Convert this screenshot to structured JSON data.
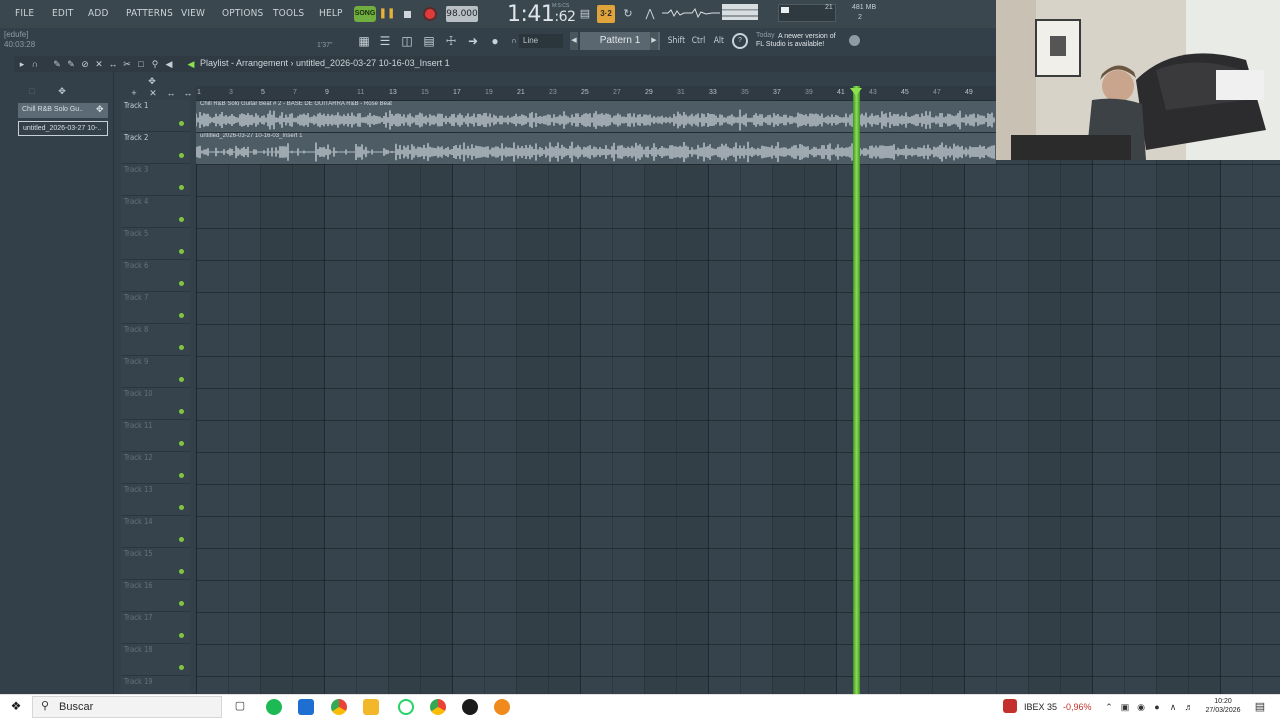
{
  "menu": [
    "FILE",
    "EDIT",
    "ADD",
    "PATTERNS",
    "VIEW",
    "OPTIONS",
    "TOOLS",
    "HELP"
  ],
  "hint": {
    "line1": "[edufe]",
    "line2": "40:03:28"
  },
  "transport": {
    "song_label": "SONG",
    "tempo": "98.000",
    "time_label": "M:S:CS",
    "time_main": "1:41",
    "time_cs": ":62",
    "hint_time": "1'37\""
  },
  "monitor": {
    "mem": "481 MB",
    "voices": "21",
    "cpu": "2"
  },
  "toolbar": {
    "snap": "Line",
    "pattern": "Pattern 1",
    "keys": [
      "Shift",
      "Ctrl",
      "Alt"
    ],
    "news_today": "Today",
    "news_text": "A newer version of",
    "news_text2": "FL Studio is available!"
  },
  "playlist": {
    "title": "Playlist - Arrangement › untitled_2026-03-27 10-16-03_Insert 1",
    "browser_items": [
      "Chill R&B Solo Gu..",
      "untitled_2026-03-27 10-.."
    ],
    "tracks": [
      "Track 1",
      "Track 2",
      "Track 3",
      "Track 4",
      "Track 5",
      "Track 6",
      "Track 7",
      "Track 8",
      "Track 9",
      "Track 10",
      "Track 11",
      "Track 12",
      "Track 13",
      "Track 14",
      "Track 15",
      "Track 16",
      "Track 17",
      "Track 18",
      "Track 19"
    ],
    "ruler": [
      "1",
      "3",
      "5",
      "7",
      "9",
      "11",
      "13",
      "15",
      "17",
      "19",
      "21",
      "23",
      "25",
      "27",
      "29",
      "31",
      "33",
      "35",
      "37",
      "39",
      "41",
      "43",
      "45",
      "47",
      "49"
    ],
    "clips": [
      {
        "label": "Chill R&B Solo Guitar Beat # 2 - BASE DE GUITARRA R&B - Rose Beat"
      },
      {
        "label": "untitled_2026-03-27 10-16-03_Insert 1"
      }
    ],
    "playhead_bar": 42.2
  },
  "taskbar": {
    "search": "Buscar",
    "ibex_label": "IBEX 35",
    "ibex_change": "-0,96%",
    "clock_time": "10:20",
    "clock_date": "27/03/2026"
  },
  "colors": {
    "accent": "#e0a43b",
    "playhead": "#8be04f",
    "led": "#7fc63f",
    "record": "#e23b3b"
  }
}
